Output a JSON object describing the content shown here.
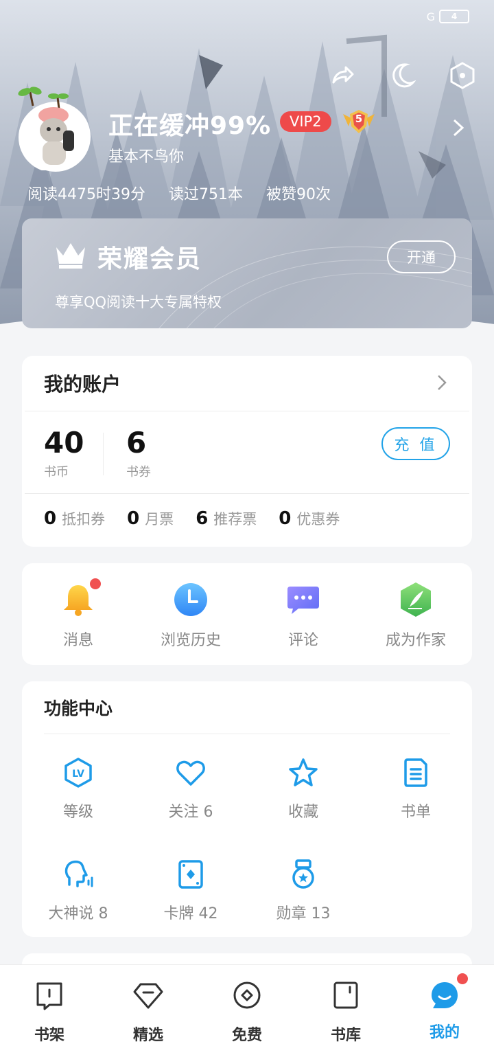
{
  "status_bar": {
    "network": "G",
    "battery": "4"
  },
  "profile": {
    "username": "正在缓冲99%",
    "vip_badge": "VIP2",
    "level_badge": "5",
    "signature": "基本不鸟你",
    "stats": [
      "阅读4475时39分",
      "读过751本",
      "被赞90次"
    ]
  },
  "vip_card": {
    "title": "荣耀会员",
    "subtitle": "尊享QQ阅读十大专属特权",
    "open_label": "开通"
  },
  "account": {
    "title": "我的账户",
    "coins": {
      "value": "40",
      "label": "书币"
    },
    "coupons": {
      "value": "6",
      "label": "书券"
    },
    "recharge_label": "充 值",
    "tickets": [
      {
        "count": "0",
        "label": "抵扣券"
      },
      {
        "count": "0",
        "label": "月票"
      },
      {
        "count": "6",
        "label": "推荐票"
      },
      {
        "count": "0",
        "label": "优惠券"
      }
    ]
  },
  "shortcuts": [
    {
      "label": "消息",
      "icon": "bell-icon"
    },
    {
      "label": "浏览历史",
      "icon": "clock-icon"
    },
    {
      "label": "评论",
      "icon": "comment-icon"
    },
    {
      "label": "成为作家",
      "icon": "quill-icon"
    }
  ],
  "function_center": {
    "title": "功能中心",
    "items": [
      {
        "label": "等级",
        "icon": "level-icon"
      },
      {
        "label": "关注 6",
        "icon": "heart-icon"
      },
      {
        "label": "收藏",
        "icon": "star-icon"
      },
      {
        "label": "书单",
        "icon": "booklist-icon"
      },
      {
        "label": "大神说 8",
        "icon": "speaker-icon"
      },
      {
        "label": "卡牌 42",
        "icon": "card-icon"
      },
      {
        "label": "勋章 13",
        "icon": "medal-icon"
      }
    ]
  },
  "bottom_nav": [
    {
      "label": "书架",
      "icon": "bookshelf-icon"
    },
    {
      "label": "精选",
      "icon": "featured-icon"
    },
    {
      "label": "免费",
      "icon": "free-icon"
    },
    {
      "label": "书库",
      "icon": "library-icon"
    },
    {
      "label": "我的",
      "icon": "me-icon",
      "active": true
    }
  ],
  "colors": {
    "accent": "#1e9be8",
    "vip": "#ee4a4a",
    "badge_dot": "#f05050"
  }
}
